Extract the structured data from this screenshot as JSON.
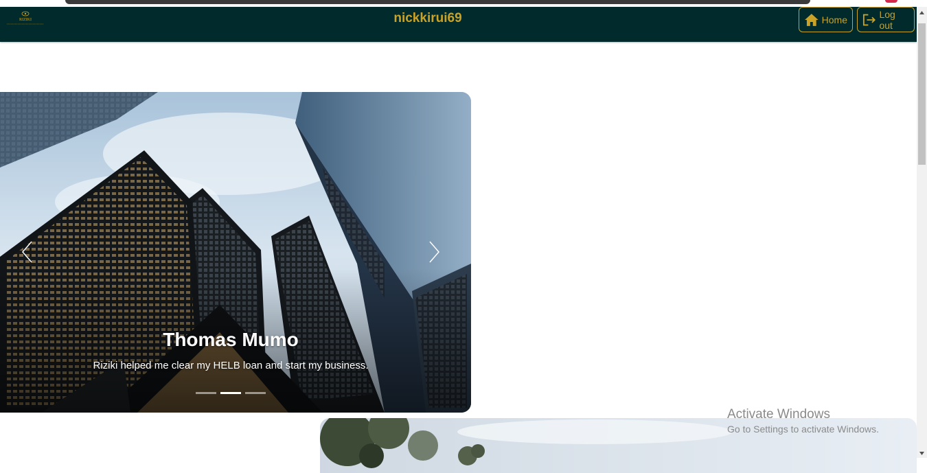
{
  "navbar": {
    "username": "nickkirui69",
    "home_label": "Home",
    "logout_label": "Log out",
    "logo_text": "RIZIKI"
  },
  "carousel": {
    "slides": [
      {
        "name": "Thomas Mumo",
        "testimonial": "Riziki helped me clear my HELB loan and start my business."
      }
    ],
    "indicator_count": 3,
    "active_index": 1
  },
  "watermark": {
    "title": "Activate Windows",
    "subtitle": "Go to Settings to activate Windows."
  },
  "colors": {
    "navbar_bg": "#002a2c",
    "accent_gold": "#c9a227"
  },
  "icons": {
    "home": "home-icon",
    "logout": "logout-icon",
    "prev": "chevron-left-icon",
    "next": "chevron-right-icon"
  }
}
